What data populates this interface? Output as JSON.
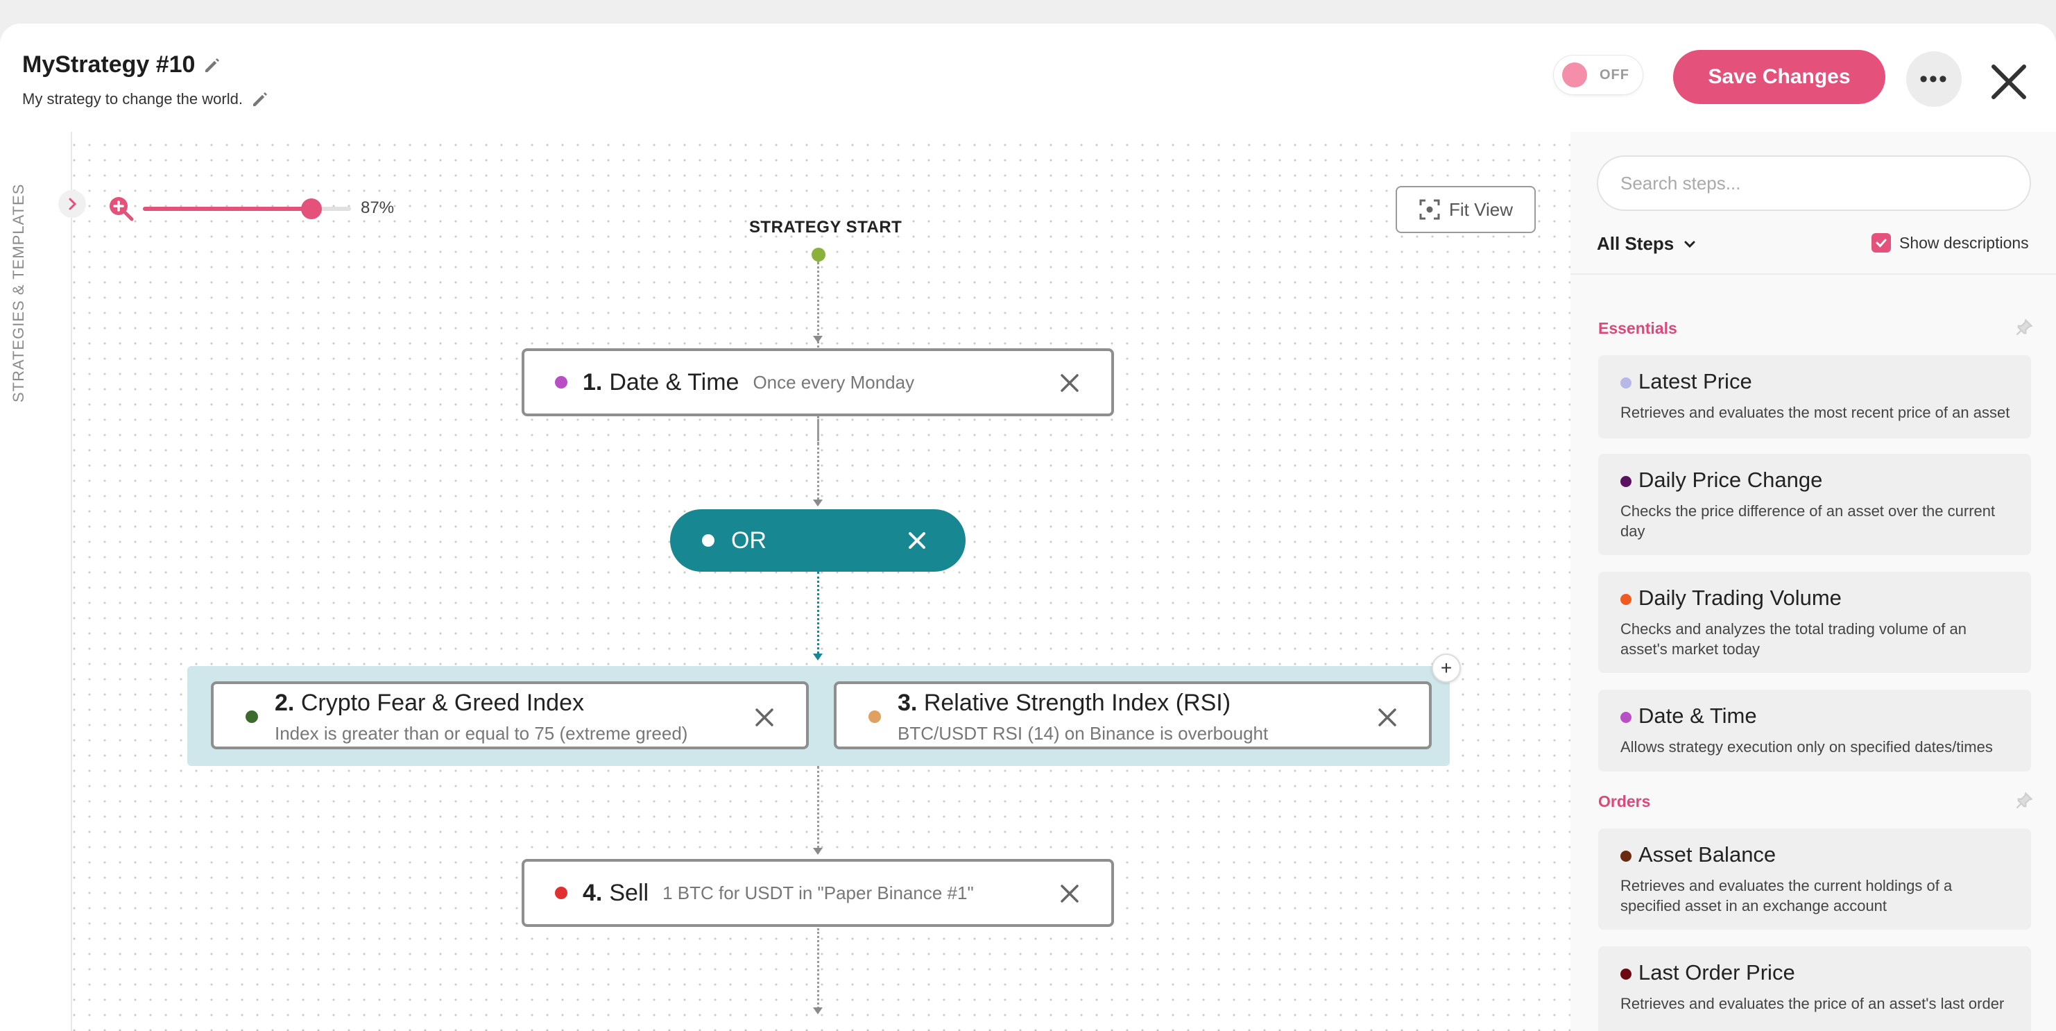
{
  "header": {
    "title": "MyStrategy #10",
    "subtitle": "My strategy to change the world.",
    "toggle_label": "OFF",
    "save_label": "Save Changes",
    "more_label": "•••"
  },
  "canvas": {
    "side_label": "STRATEGIES & TEMPLATES",
    "zoom": {
      "percent": 87,
      "label": "87%"
    },
    "fit_view_label": "Fit View",
    "start_label": "STRATEGY START",
    "or_label": "OR",
    "group_add_label": "+",
    "steps": [
      {
        "num": "1.",
        "name": "Date & Time",
        "desc": "Once every Monday",
        "color": "#b94fc5"
      },
      {
        "num": "2.",
        "name": "Crypto Fear & Greed Index",
        "desc": "Index is greater than or equal to 75 (extreme greed)",
        "color": "#3d6b2e"
      },
      {
        "num": "3.",
        "name": "Relative Strength Index (RSI)",
        "desc": "BTC/USDT RSI (14) on Binance is overbought",
        "color": "#e0a060"
      },
      {
        "num": "4.",
        "name": "Sell",
        "desc": "1 BTC for USDT in \"Paper Binance #1\"",
        "color": "#e03030"
      }
    ]
  },
  "panel": {
    "search_placeholder": "Search steps...",
    "filter_label": "All Steps",
    "show_descriptions_label": "Show descriptions",
    "show_descriptions_checked": true,
    "sections": [
      {
        "title": "Essentials",
        "items": [
          {
            "title": "Latest Price",
            "desc": "Retrieves and evaluates the most recent price of an asset",
            "color": "#b8b8e8"
          },
          {
            "title": "Daily Price Change",
            "desc": "Checks the price difference of an asset over the current day",
            "color": "#5a1060"
          },
          {
            "title": "Daily Trading Volume",
            "desc": "Checks and analyzes the total trading volume of an asset's market today",
            "color": "#f05a20"
          },
          {
            "title": "Date & Time",
            "desc": "Allows strategy execution only on specified dates/times",
            "color": "#b94fc5"
          }
        ]
      },
      {
        "title": "Orders",
        "items": [
          {
            "title": "Asset Balance",
            "desc": "Retrieves and evaluates the current holdings of a specified asset in an exchange account",
            "color": "#6a2a10"
          },
          {
            "title": "Last Order Price",
            "desc": "Retrieves and evaluates the price of an asset's last order",
            "color": "#6a0a10"
          }
        ]
      }
    ]
  }
}
